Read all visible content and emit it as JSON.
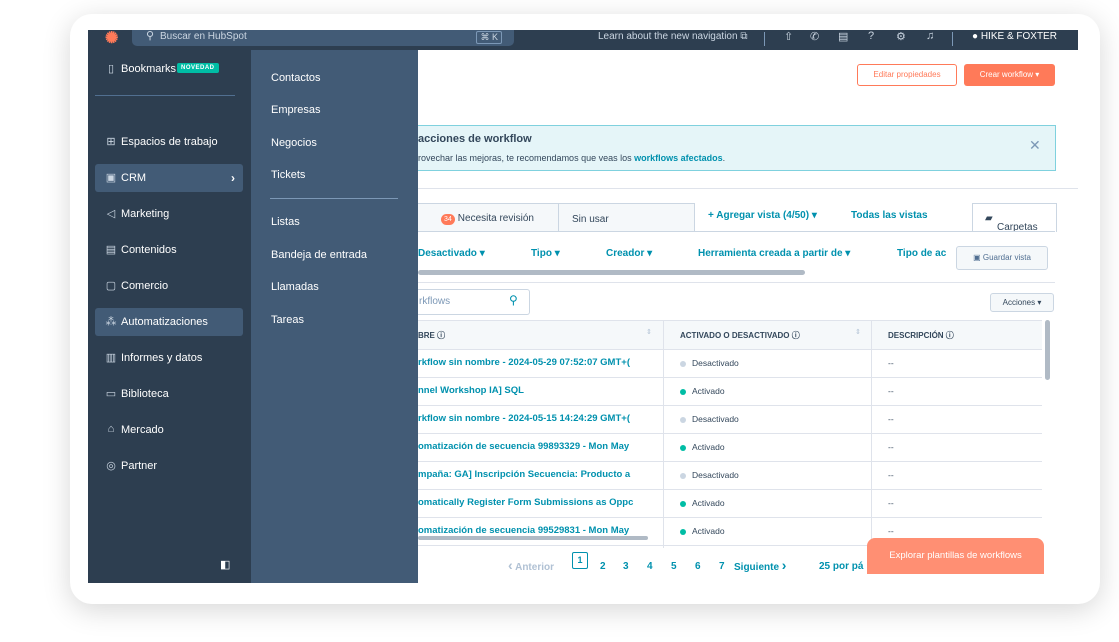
{
  "topbar": {
    "search_placeholder": "Buscar en HubSpot",
    "search_shortcut": "⌘ K",
    "learn_text": "Learn about the new navigation",
    "account_name": "HIKE & FOXTER"
  },
  "nav": {
    "bookmarks_label": "Bookmarks",
    "bookmarks_badge": "NOVEDAD",
    "items": [
      {
        "label": "Espacios de trabajo",
        "icon": "grid-icon"
      },
      {
        "label": "CRM",
        "icon": "crm-icon"
      },
      {
        "label": "Marketing",
        "icon": "megaphone-icon"
      },
      {
        "label": "Contenidos",
        "icon": "content-icon"
      },
      {
        "label": "Comercio",
        "icon": "commerce-icon"
      },
      {
        "label": "Automatizaciones",
        "icon": "automation-icon"
      },
      {
        "label": "Informes y datos",
        "icon": "chart-icon"
      },
      {
        "label": "Biblioteca",
        "icon": "folder-icon"
      },
      {
        "label": "Mercado",
        "icon": "store-icon"
      },
      {
        "label": "Partner",
        "icon": "partner-icon"
      }
    ]
  },
  "flyout": {
    "items": [
      "Contactos",
      "Empresas",
      "Negocios",
      "Tickets",
      "Listas",
      "Bandeja de entrada",
      "Llamadas",
      "Tareas"
    ]
  },
  "header": {
    "edit_properties": "Editar propiedades",
    "create_workflow": "Crear workflow ▾"
  },
  "banner": {
    "title": "acciones de workflow",
    "body_prefix": "rovechar las mejoras, te recomendamos que veas los ",
    "body_link": "workflows afectados",
    "body_suffix": "."
  },
  "tabs": {
    "review_count": "34",
    "review_label": "Necesita revisión",
    "unused_label": "Sin usar",
    "add_view": "+ Agregar vista (4/50) ▾",
    "all_views": "Todas las vistas",
    "folders": "Carpetas"
  },
  "filters": {
    "items": [
      "Desactivado ▾",
      "Tipo ▾",
      "Creador ▾",
      "Herramienta creada a partir de ▾",
      "Tipo de ac"
    ],
    "save_view": "Guardar vista"
  },
  "table": {
    "search_placeholder": "rkflows",
    "actions_label": "Acciones ▾",
    "columns": [
      "BRE",
      "ACTIVADO O DESACTIVADO",
      "DESCRIPCIÓN"
    ],
    "rows": [
      {
        "name": "rkflow sin nombre - 2024-05-29 07:52:07 GMT+(",
        "status": "Desactivado",
        "active": false,
        "desc": "--"
      },
      {
        "name": "nnel Workshop IA] SQL",
        "status": "Activado",
        "active": true,
        "desc": "--"
      },
      {
        "name": "rkflow sin nombre - 2024-05-15 14:24:29 GMT+(",
        "status": "Desactivado",
        "active": false,
        "desc": "--"
      },
      {
        "name": "omatización de secuencia 99893329 - Mon May",
        "status": "Activado",
        "active": true,
        "desc": "--"
      },
      {
        "name": "mpaña: GA] Inscripción Secuencia: Producto a",
        "status": "Desactivado",
        "active": false,
        "desc": "--"
      },
      {
        "name": "omatically Register Form Submissions as Oppc",
        "status": "Activado",
        "active": true,
        "desc": "--"
      },
      {
        "name": "omatización de secuencia 99529831 - Mon May",
        "status": "Activado",
        "active": true,
        "desc": "--"
      }
    ]
  },
  "pagination": {
    "prev": "Anterior",
    "pages": [
      "1",
      "2",
      "3",
      "4",
      "5",
      "6",
      "7"
    ],
    "next": "Siguiente",
    "per_page": "25 por pá"
  },
  "explore_button": "Explorar plantillas de workflows",
  "colors": {
    "brand": "#ff7a59",
    "link": "#0091ae",
    "nav": "#2d3e50",
    "flyout": "#425b76",
    "active_dot": "#00bda5",
    "inactive_dot": "#cbd6e2"
  }
}
